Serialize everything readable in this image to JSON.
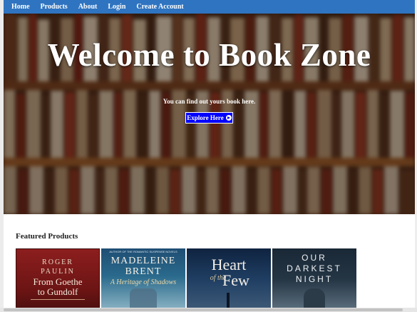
{
  "nav": {
    "items": [
      {
        "label": "Home"
      },
      {
        "label": "Products"
      },
      {
        "label": "About"
      },
      {
        "label": "Login"
      },
      {
        "label": "Create Account"
      }
    ]
  },
  "hero": {
    "title": "Welcome to Book Zone",
    "subtitle": "You can find out yours book here.",
    "button_label": "Explore Here",
    "button_icon": "arrow-circle-right-icon"
  },
  "featured": {
    "heading": "Featured Products",
    "books": [
      {
        "author_first": "ROGER",
        "author_last": "PAULIN",
        "title_line1": "From Goethe",
        "title_line2": "to Gundolf"
      },
      {
        "series_line": "AUTHOR OF THE ROMANTIC SUSPENSE NOVELS",
        "author_first": "MADELEINE",
        "author_last": "BRENT",
        "title": "A Heritage of Shadows"
      },
      {
        "title_line1": "Heart",
        "title_line2": "of the",
        "title_line3": "Few"
      },
      {
        "title_line1": "OUR",
        "title_line2": "DARKEST",
        "title_line3": "NIGHT"
      }
    ]
  },
  "colors": {
    "nav_bg": "#2f74c0",
    "button_bg": "#0000ff"
  }
}
